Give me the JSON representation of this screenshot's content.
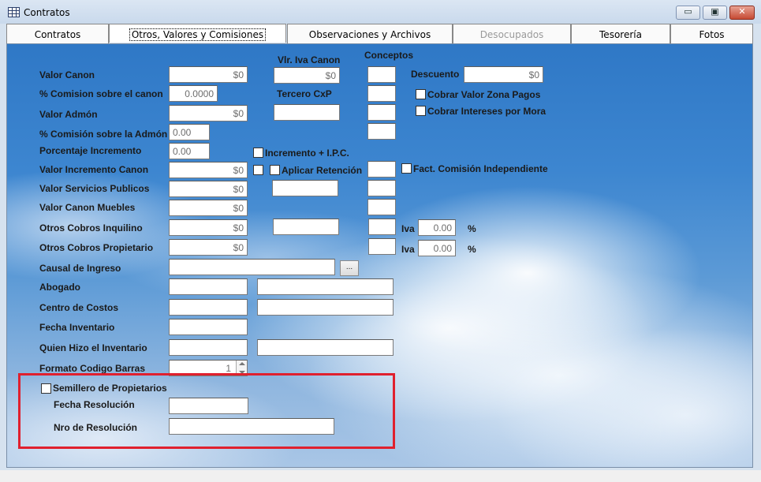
{
  "window": {
    "title": "Contratos"
  },
  "window_buttons": {
    "minimize": "▭",
    "maximize": "▣",
    "close": "✕"
  },
  "tabs": [
    {
      "label": "Contratos"
    },
    {
      "label": "Otros, Valores y Comisiones"
    },
    {
      "label": "Observaciones y Archivos"
    },
    {
      "label": "Desocupados"
    },
    {
      "label": "Tesorería"
    },
    {
      "label": "Fotos"
    }
  ],
  "headers": {
    "vlr_iva_canon": "Vlr. Iva Canon",
    "conceptos": "Conceptos",
    "tercero_cxp": "Tercero CxP",
    "descuento": "Descuento"
  },
  "fields": {
    "valor_canon": {
      "label": "Valor Canon",
      "value": "$0"
    },
    "comision_canon": {
      "label": "% Comision sobre el canon",
      "value": "0.0000"
    },
    "valor_admon": {
      "label": "Valor Admón",
      "value": "$0"
    },
    "comision_admon": {
      "label": "% Comisión sobre la Admón",
      "value": "0.00"
    },
    "porcentaje_incremento": {
      "label": "Porcentaje Incremento",
      "value": "0.00"
    },
    "valor_incremento_canon": {
      "label": "Valor Incremento Canon",
      "value": "$0"
    },
    "valor_servicios_publicos": {
      "label": "Valor Servicios Publicos",
      "value": "$0"
    },
    "valor_canon_muebles": {
      "label": "Valor Canon Muebles",
      "value": "$0"
    },
    "otros_cobros_inquilino": {
      "label": "Otros Cobros Inquilino",
      "value": "$0"
    },
    "otros_cobros_propietario": {
      "label": "Otros Cobros Propietario",
      "value": "$0"
    },
    "causal_ingreso": {
      "label": "Causal de Ingreso",
      "value": "",
      "button": "..."
    },
    "abogado": {
      "label": "Abogado",
      "value": ""
    },
    "centro_costos": {
      "label": "Centro de Costos",
      "value": ""
    },
    "fecha_inventario": {
      "label": "Fecha Inventario",
      "value": ""
    },
    "quien_hizo_inventario": {
      "label": "Quien Hizo el Inventario",
      "value": ""
    },
    "formato_codigo_barras": {
      "label": "Formato Codigo Barras",
      "value": "1"
    },
    "vlr_iva_canon": {
      "value": "$0"
    },
    "descuento": {
      "value": "$0"
    },
    "iva_inquilino": {
      "label": "Iva",
      "value": "0.00",
      "unit": "%"
    },
    "iva_propietario": {
      "label": "Iva",
      "value": "0.00",
      "unit": "%"
    }
  },
  "checkboxes": {
    "cobrar_valor_zona_pagos": {
      "label": "Cobrar Valor Zona Pagos",
      "checked": false
    },
    "cobrar_intereses_mora": {
      "label": "Cobrar Intereses por Mora",
      "checked": false
    },
    "incremento_ipc": {
      "label": "Incremento + I.P.C.",
      "checked": false
    },
    "aplicar_retencion": {
      "label": "Aplicar Retención",
      "checked": false
    },
    "fact_comision_independiente": {
      "label": "Fact. Comisión Independiente",
      "checked": false
    },
    "semillero_propietarios": {
      "label": "Semillero de Propietarios",
      "checked": false
    }
  },
  "semillero": {
    "fecha_resolucion": {
      "label": "Fecha Resolución",
      "value": ""
    },
    "nro_resolucion": {
      "label": "Nro de Resolución",
      "value": ""
    }
  },
  "colors": {
    "highlight_border": "#e0202e",
    "sky": "#3d86d0"
  }
}
